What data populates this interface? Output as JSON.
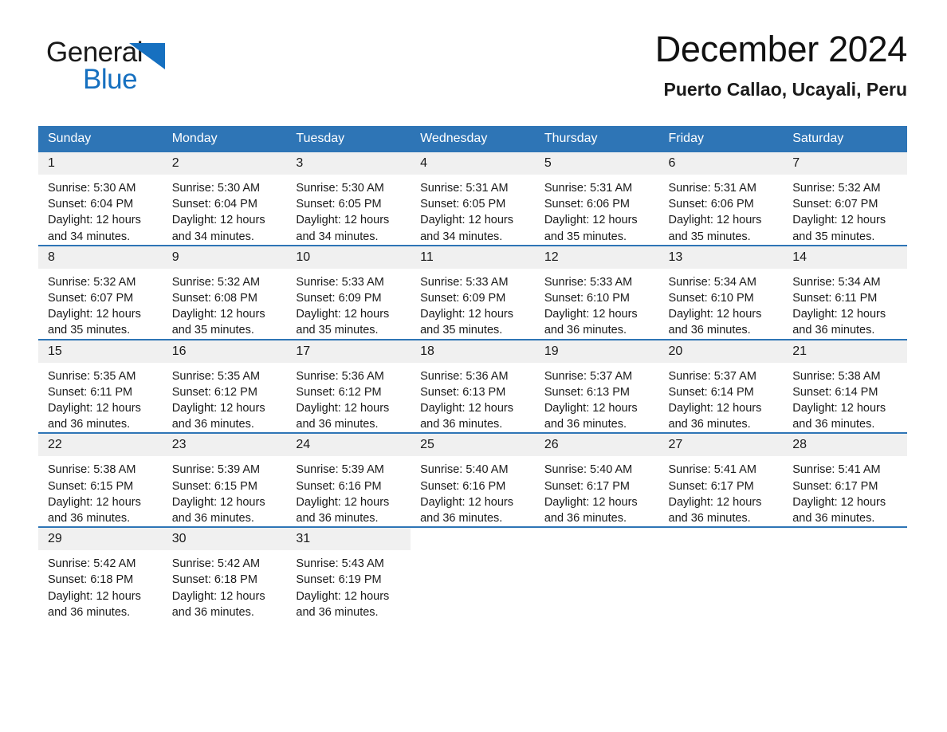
{
  "brand": {
    "name_part1": "General",
    "name_part2": "Blue",
    "accent_color": "#1670c0"
  },
  "header": {
    "title": "December 2024",
    "location": "Puerto Callao, Ucayali, Peru"
  },
  "theme": {
    "header_bg": "#2e75b6",
    "header_text": "#ffffff",
    "daynum_bg": "#f0f0f0",
    "row_divider": "#2e75b6"
  },
  "weekday_headers": [
    "Sunday",
    "Monday",
    "Tuesday",
    "Wednesday",
    "Thursday",
    "Friday",
    "Saturday"
  ],
  "labels": {
    "sunrise_prefix": "Sunrise:",
    "sunset_prefix": "Sunset:",
    "daylight_prefix": "Daylight:"
  },
  "weeks": [
    [
      {
        "day": "1",
        "sunrise": "Sunrise: 5:30 AM",
        "sunset": "Sunset: 6:04 PM",
        "daylight_l1": "Daylight: 12 hours",
        "daylight_l2": "and 34 minutes."
      },
      {
        "day": "2",
        "sunrise": "Sunrise: 5:30 AM",
        "sunset": "Sunset: 6:04 PM",
        "daylight_l1": "Daylight: 12 hours",
        "daylight_l2": "and 34 minutes."
      },
      {
        "day": "3",
        "sunrise": "Sunrise: 5:30 AM",
        "sunset": "Sunset: 6:05 PM",
        "daylight_l1": "Daylight: 12 hours",
        "daylight_l2": "and 34 minutes."
      },
      {
        "day": "4",
        "sunrise": "Sunrise: 5:31 AM",
        "sunset": "Sunset: 6:05 PM",
        "daylight_l1": "Daylight: 12 hours",
        "daylight_l2": "and 34 minutes."
      },
      {
        "day": "5",
        "sunrise": "Sunrise: 5:31 AM",
        "sunset": "Sunset: 6:06 PM",
        "daylight_l1": "Daylight: 12 hours",
        "daylight_l2": "and 35 minutes."
      },
      {
        "day": "6",
        "sunrise": "Sunrise: 5:31 AM",
        "sunset": "Sunset: 6:06 PM",
        "daylight_l1": "Daylight: 12 hours",
        "daylight_l2": "and 35 minutes."
      },
      {
        "day": "7",
        "sunrise": "Sunrise: 5:32 AM",
        "sunset": "Sunset: 6:07 PM",
        "daylight_l1": "Daylight: 12 hours",
        "daylight_l2": "and 35 minutes."
      }
    ],
    [
      {
        "day": "8",
        "sunrise": "Sunrise: 5:32 AM",
        "sunset": "Sunset: 6:07 PM",
        "daylight_l1": "Daylight: 12 hours",
        "daylight_l2": "and 35 minutes."
      },
      {
        "day": "9",
        "sunrise": "Sunrise: 5:32 AM",
        "sunset": "Sunset: 6:08 PM",
        "daylight_l1": "Daylight: 12 hours",
        "daylight_l2": "and 35 minutes."
      },
      {
        "day": "10",
        "sunrise": "Sunrise: 5:33 AM",
        "sunset": "Sunset: 6:09 PM",
        "daylight_l1": "Daylight: 12 hours",
        "daylight_l2": "and 35 minutes."
      },
      {
        "day": "11",
        "sunrise": "Sunrise: 5:33 AM",
        "sunset": "Sunset: 6:09 PM",
        "daylight_l1": "Daylight: 12 hours",
        "daylight_l2": "and 35 minutes."
      },
      {
        "day": "12",
        "sunrise": "Sunrise: 5:33 AM",
        "sunset": "Sunset: 6:10 PM",
        "daylight_l1": "Daylight: 12 hours",
        "daylight_l2": "and 36 minutes."
      },
      {
        "day": "13",
        "sunrise": "Sunrise: 5:34 AM",
        "sunset": "Sunset: 6:10 PM",
        "daylight_l1": "Daylight: 12 hours",
        "daylight_l2": "and 36 minutes."
      },
      {
        "day": "14",
        "sunrise": "Sunrise: 5:34 AM",
        "sunset": "Sunset: 6:11 PM",
        "daylight_l1": "Daylight: 12 hours",
        "daylight_l2": "and 36 minutes."
      }
    ],
    [
      {
        "day": "15",
        "sunrise": "Sunrise: 5:35 AM",
        "sunset": "Sunset: 6:11 PM",
        "daylight_l1": "Daylight: 12 hours",
        "daylight_l2": "and 36 minutes."
      },
      {
        "day": "16",
        "sunrise": "Sunrise: 5:35 AM",
        "sunset": "Sunset: 6:12 PM",
        "daylight_l1": "Daylight: 12 hours",
        "daylight_l2": "and 36 minutes."
      },
      {
        "day": "17",
        "sunrise": "Sunrise: 5:36 AM",
        "sunset": "Sunset: 6:12 PM",
        "daylight_l1": "Daylight: 12 hours",
        "daylight_l2": "and 36 minutes."
      },
      {
        "day": "18",
        "sunrise": "Sunrise: 5:36 AM",
        "sunset": "Sunset: 6:13 PM",
        "daylight_l1": "Daylight: 12 hours",
        "daylight_l2": "and 36 minutes."
      },
      {
        "day": "19",
        "sunrise": "Sunrise: 5:37 AM",
        "sunset": "Sunset: 6:13 PM",
        "daylight_l1": "Daylight: 12 hours",
        "daylight_l2": "and 36 minutes."
      },
      {
        "day": "20",
        "sunrise": "Sunrise: 5:37 AM",
        "sunset": "Sunset: 6:14 PM",
        "daylight_l1": "Daylight: 12 hours",
        "daylight_l2": "and 36 minutes."
      },
      {
        "day": "21",
        "sunrise": "Sunrise: 5:38 AM",
        "sunset": "Sunset: 6:14 PM",
        "daylight_l1": "Daylight: 12 hours",
        "daylight_l2": "and 36 minutes."
      }
    ],
    [
      {
        "day": "22",
        "sunrise": "Sunrise: 5:38 AM",
        "sunset": "Sunset: 6:15 PM",
        "daylight_l1": "Daylight: 12 hours",
        "daylight_l2": "and 36 minutes."
      },
      {
        "day": "23",
        "sunrise": "Sunrise: 5:39 AM",
        "sunset": "Sunset: 6:15 PM",
        "daylight_l1": "Daylight: 12 hours",
        "daylight_l2": "and 36 minutes."
      },
      {
        "day": "24",
        "sunrise": "Sunrise: 5:39 AM",
        "sunset": "Sunset: 6:16 PM",
        "daylight_l1": "Daylight: 12 hours",
        "daylight_l2": "and 36 minutes."
      },
      {
        "day": "25",
        "sunrise": "Sunrise: 5:40 AM",
        "sunset": "Sunset: 6:16 PM",
        "daylight_l1": "Daylight: 12 hours",
        "daylight_l2": "and 36 minutes."
      },
      {
        "day": "26",
        "sunrise": "Sunrise: 5:40 AM",
        "sunset": "Sunset: 6:17 PM",
        "daylight_l1": "Daylight: 12 hours",
        "daylight_l2": "and 36 minutes."
      },
      {
        "day": "27",
        "sunrise": "Sunrise: 5:41 AM",
        "sunset": "Sunset: 6:17 PM",
        "daylight_l1": "Daylight: 12 hours",
        "daylight_l2": "and 36 minutes."
      },
      {
        "day": "28",
        "sunrise": "Sunrise: 5:41 AM",
        "sunset": "Sunset: 6:17 PM",
        "daylight_l1": "Daylight: 12 hours",
        "daylight_l2": "and 36 minutes."
      }
    ],
    [
      {
        "day": "29",
        "sunrise": "Sunrise: 5:42 AM",
        "sunset": "Sunset: 6:18 PM",
        "daylight_l1": "Daylight: 12 hours",
        "daylight_l2": "and 36 minutes."
      },
      {
        "day": "30",
        "sunrise": "Sunrise: 5:42 AM",
        "sunset": "Sunset: 6:18 PM",
        "daylight_l1": "Daylight: 12 hours",
        "daylight_l2": "and 36 minutes."
      },
      {
        "day": "31",
        "sunrise": "Sunrise: 5:43 AM",
        "sunset": "Sunset: 6:19 PM",
        "daylight_l1": "Daylight: 12 hours",
        "daylight_l2": "and 36 minutes."
      },
      {
        "day": "",
        "sunrise": "",
        "sunset": "",
        "daylight_l1": "",
        "daylight_l2": ""
      },
      {
        "day": "",
        "sunrise": "",
        "sunset": "",
        "daylight_l1": "",
        "daylight_l2": ""
      },
      {
        "day": "",
        "sunrise": "",
        "sunset": "",
        "daylight_l1": "",
        "daylight_l2": ""
      },
      {
        "day": "",
        "sunrise": "",
        "sunset": "",
        "daylight_l1": "",
        "daylight_l2": ""
      }
    ]
  ]
}
